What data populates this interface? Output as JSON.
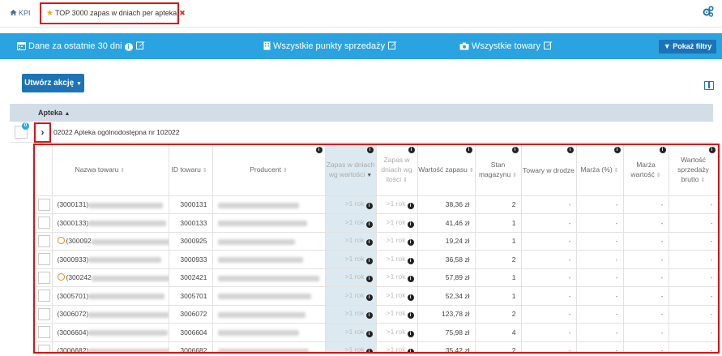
{
  "tabs": {
    "kpi_label": "KPI",
    "active_label": "TOP 3000 zapas w dniach per apteka"
  },
  "filterbar": {
    "period": "Dane za ostatnie 30 dni",
    "points": "Wszystkie punkty sprzedaży",
    "products": "Wszystkie towary",
    "show_filters": "Pokaż filtry"
  },
  "actions": {
    "create_action": "Utwórz akcję"
  },
  "group": {
    "header": "Apteka",
    "count": "0",
    "name": "02022 Apteka ogólnodostępna nr 102022"
  },
  "table": {
    "headers": {
      "name": "Nazwa towaru",
      "id": "ID towaru",
      "producer": "Producent",
      "stock_days_value": "Zapas w dniach wg wartości",
      "stock_days_qty": "Zapas w dniach wg ilości",
      "stock_value": "Wartość zapasu",
      "stock_qty": "Stan magazynu",
      "in_transit": "Towary w drodze",
      "margin_pct": "Marża (%)",
      "margin_value": "Marża wartość",
      "sales_gross": "Wartość sprzedaży brutto"
    },
    "rows": [
      {
        "name": "(3000131)",
        "warn": false,
        "id": "3000131",
        "zv": ">1 rok",
        "zq": ">1 rok",
        "value": "38,36 zł",
        "qty": "2",
        "transit": "-",
        "mpct": "-",
        "mval": "-",
        "sales": "-"
      },
      {
        "name": "(3000133)",
        "warn": false,
        "id": "3000133",
        "zv": ">1 rok",
        "zq": ">1 rok",
        "value": "41,46 zł",
        "qty": "1",
        "transit": "-",
        "mpct": "-",
        "mval": "-",
        "sales": "-"
      },
      {
        "name": "(300092",
        "warn": true,
        "id": "3000925",
        "zv": ">1 rok",
        "zq": ">1 rok",
        "value": "19,24 zł",
        "qty": "1",
        "transit": "-",
        "mpct": "-",
        "mval": "-",
        "sales": "-"
      },
      {
        "name": "(3000933)",
        "warn": false,
        "id": "3000933",
        "zv": ">1 rok",
        "zq": ">1 rok",
        "value": "36,58 zł",
        "qty": "2",
        "transit": "-",
        "mpct": "-",
        "mval": "-",
        "sales": "-"
      },
      {
        "name": "(300242",
        "warn": true,
        "id": "3002421",
        "zv": ">1 rok",
        "zq": ">1 rok",
        "value": "57,89 zł",
        "qty": "1",
        "transit": "-",
        "mpct": "-",
        "mval": "-",
        "sales": "-"
      },
      {
        "name": "(3005701)",
        "warn": false,
        "id": "3005701",
        "zv": ">1 rok",
        "zq": ">1 rok",
        "value": "52,34 zł",
        "qty": "1",
        "transit": "-",
        "mpct": "-",
        "mval": "-",
        "sales": "-"
      },
      {
        "name": "(3006072)",
        "warn": false,
        "id": "3006072",
        "zv": ">1 rok",
        "zq": ">1 rok",
        "value": "123,78 zł",
        "qty": "2",
        "transit": "-",
        "mpct": "-",
        "mval": "-",
        "sales": "-"
      },
      {
        "name": "(3006604)",
        "warn": false,
        "id": "3006604",
        "zv": ">1 rok",
        "zq": ">1 rok",
        "value": "75,98 zł",
        "qty": "4",
        "transit": "-",
        "mpct": "-",
        "mval": "-",
        "sales": "-"
      },
      {
        "name": "(3006682)",
        "warn": false,
        "id": "3006682",
        "zv": ">1 rok",
        "zq": ">1 rok",
        "value": "35,42 zł",
        "qty": "2",
        "transit": "-",
        "mpct": "-",
        "mval": "-",
        "sales": "-"
      }
    ]
  }
}
